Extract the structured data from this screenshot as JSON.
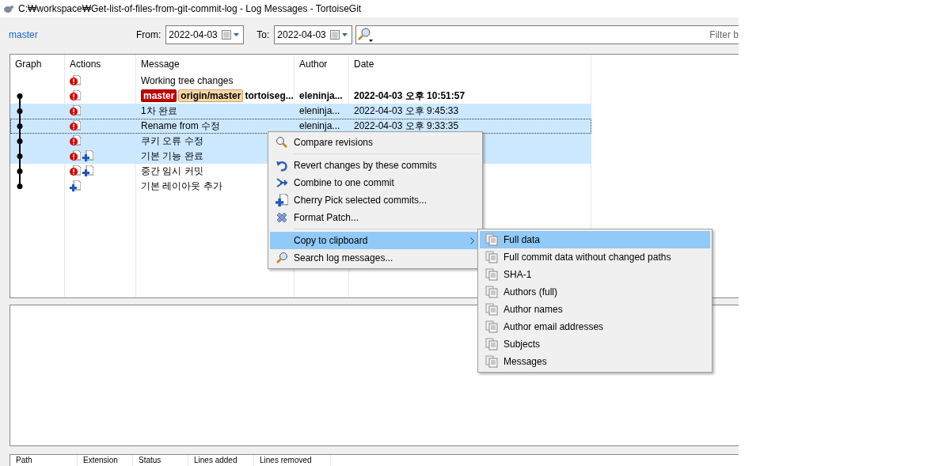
{
  "window": {
    "title": "C:₩workspace₩Get-list-of-files-from-git-commit-log - Log Messages - TortoiseGit"
  },
  "toolbar": {
    "branch": "master",
    "from_label": "From:",
    "from_date": "2022-04-03",
    "to_label": "To:",
    "to_date": "2022-04-03",
    "filter": {
      "placeholder": "Filter b"
    }
  },
  "log": {
    "columns": [
      "Graph",
      "Actions",
      "Message",
      "Author",
      "Date"
    ],
    "rows": [
      {
        "kind": "working_tree",
        "actions": [
          {
            "kind": "modified"
          }
        ],
        "refs": [],
        "message": "Working tree changes",
        "author": "",
        "date": "",
        "bold": false,
        "selected": false
      },
      {
        "kind": "commit",
        "actions": [
          {
            "kind": "modified"
          }
        ],
        "refs": [
          {
            "label": "master",
            "kind": "local"
          },
          {
            "label": "origin/master",
            "kind": "remote"
          }
        ],
        "message": "tortoiseg...",
        "author": "eleninja...",
        "date": "2022-04-03 오후 10:51:57",
        "bold": true,
        "selected": false
      },
      {
        "kind": "commit",
        "actions": [
          {
            "kind": "modified"
          }
        ],
        "refs": [],
        "message": "1차 완료",
        "author": "eleninja...",
        "date": "2022-04-03 오후 9:45:33",
        "bold": false,
        "selected": true
      },
      {
        "kind": "commit",
        "actions": [
          {
            "kind": "modified"
          }
        ],
        "refs": [],
        "message": "Rename from 수정",
        "author": "eleninja...",
        "date": "2022-04-03 오후 9:33:35",
        "bold": false,
        "selected": true,
        "focused": true
      },
      {
        "kind": "commit",
        "actions": [
          {
            "kind": "modified"
          }
        ],
        "refs": [],
        "message": "쿠키 오류 수정",
        "author": "",
        "date": "",
        "bold": false,
        "selected": true
      },
      {
        "kind": "commit",
        "actions": [
          {
            "kind": "modified"
          },
          {
            "kind": "added"
          }
        ],
        "refs": [],
        "message": "기본 기능 완료",
        "author": "",
        "date": "",
        "bold": false,
        "selected": true
      },
      {
        "kind": "commit",
        "actions": [
          {
            "kind": "modified"
          },
          {
            "kind": "added"
          }
        ],
        "refs": [],
        "message": "중간 임시 커밋",
        "author": "",
        "date": "",
        "bold": false,
        "selected": false
      },
      {
        "kind": "commit",
        "actions": [
          {
            "kind": "added"
          }
        ],
        "refs": [],
        "message": "기본 레이아웃 추가",
        "author": "",
        "date": "",
        "bold": false,
        "selected": false
      }
    ]
  },
  "files": {
    "columns": [
      "Path",
      "Extension",
      "Status",
      "Lines added",
      "Lines removed"
    ]
  },
  "context_menu": {
    "items": [
      {
        "kind": "compare",
        "label": "Compare revisions",
        "selected": false
      },
      {
        "kind": "separator"
      },
      {
        "kind": "revert",
        "label": "Revert changes by these commits",
        "selected": false
      },
      {
        "kind": "combine",
        "label": "Combine to one commit",
        "selected": false
      },
      {
        "kind": "cherry_pick",
        "label": "Cherry Pick selected commits...",
        "selected": false
      },
      {
        "kind": "patch",
        "label": "Format Patch...",
        "selected": false
      },
      {
        "kind": "separator"
      },
      {
        "kind": "submenu",
        "label": "Copy to clipboard",
        "selected": true
      },
      {
        "kind": "search",
        "label": "Search log messages...",
        "selected": false
      }
    ]
  },
  "submenu": {
    "items": [
      {
        "label": "Full data",
        "selected": true
      },
      {
        "label": "Full commit data without changed paths",
        "selected": false
      },
      {
        "label": "SHA-1",
        "selected": false
      },
      {
        "label": "Authors (full)",
        "selected": false
      },
      {
        "label": "Author names",
        "selected": false
      },
      {
        "label": "Author email addresses",
        "selected": false
      },
      {
        "label": "Subjects",
        "selected": false
      },
      {
        "label": "Messages",
        "selected": false
      }
    ]
  }
}
